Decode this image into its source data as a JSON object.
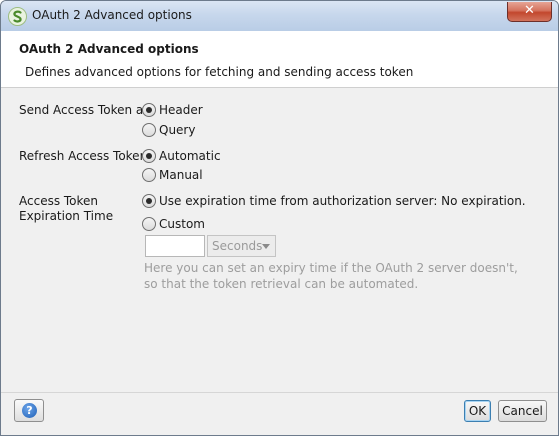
{
  "window": {
    "title": "OAuth 2 Advanced options",
    "close_label": "✕"
  },
  "header": {
    "title": "OAuth 2 Advanced options",
    "description": "Defines advanced options for fetching and sending access token"
  },
  "send_token": {
    "label": "Send Access Token as:",
    "options": [
      {
        "label": "Header",
        "selected": true
      },
      {
        "label": "Query",
        "selected": false
      }
    ]
  },
  "refresh_token": {
    "label": "Refresh Access Token:",
    "options": [
      {
        "label": "Automatic",
        "selected": true
      },
      {
        "label": "Manual",
        "selected": false
      }
    ]
  },
  "expiration": {
    "label_line1": "Access Token",
    "label_line2": "Expiration Time",
    "options": [
      {
        "label": "Use expiration time from authorization server: No expiration.",
        "selected": true
      },
      {
        "label": "Custom",
        "selected": false
      }
    ],
    "custom_value": "",
    "unit": "Seconds",
    "hint_line1": "Here you can set an expiry time if the OAuth 2 server doesn't,",
    "hint_line2": "so that the token retrieval can be automated."
  },
  "footer": {
    "help_label": "?",
    "ok_label": "OK",
    "cancel_label": "Cancel"
  }
}
